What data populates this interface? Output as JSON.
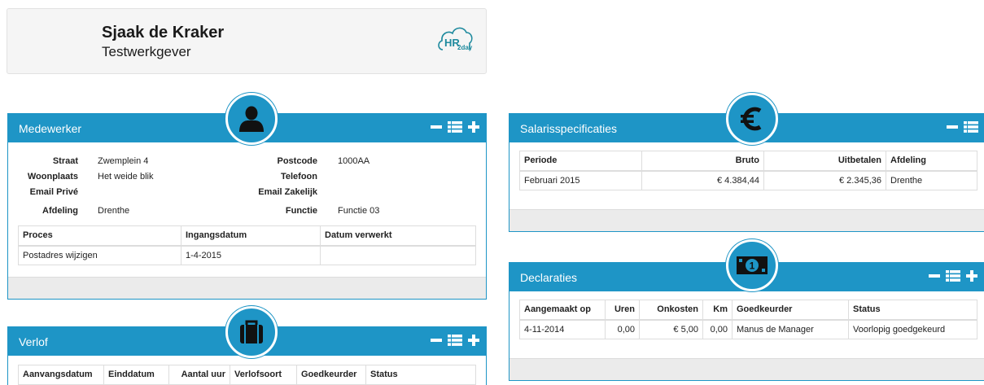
{
  "header": {
    "employee_name": "Sjaak de Kraker",
    "employer": "Testwerkgever",
    "logo_text_main": "HR",
    "logo_text_sub": "2day",
    "logo_icon": "hr2day-cloud-logo"
  },
  "colors": {
    "accent": "#1e95c6",
    "footer": "#ebebeb"
  },
  "medewerker": {
    "title": "Medewerker",
    "icon": "person-icon",
    "fields_left": [
      {
        "label": "Straat",
        "value": "Zwemplein 4"
      },
      {
        "label": "Woonplaats",
        "value": "Het weide blik"
      },
      {
        "label": "Email Privé",
        "value": ""
      },
      {
        "label": "Afdeling",
        "value": "Drenthe"
      }
    ],
    "fields_right": [
      {
        "label": "Postcode",
        "value": "1000AA"
      },
      {
        "label": "Telefoon",
        "value": ""
      },
      {
        "label": "Email Zakelijk",
        "value": ""
      },
      {
        "label": "Functie",
        "value": "Functie 03"
      }
    ],
    "columns": [
      "Proces",
      "Ingangsdatum",
      "Datum verwerkt"
    ],
    "rows": [
      [
        "Postadres wijzigen",
        "1-4-2015",
        ""
      ]
    ]
  },
  "verlof": {
    "title": "Verlof",
    "icon": "briefcase-icon",
    "columns": [
      "Aanvangsdatum",
      "Einddatum",
      "Aantal uur",
      "Verlofsoort",
      "Goedkeurder",
      "Status"
    ]
  },
  "salaris": {
    "title": "Salarisspecificaties",
    "icon": "euro-icon",
    "columns": [
      "Periode",
      "Bruto",
      "Uitbetalen",
      "Afdeling"
    ],
    "rows": [
      [
        "Februari 2015",
        "€ 4.384,44",
        "€ 2.345,36",
        "Drenthe"
      ]
    ]
  },
  "declaraties": {
    "title": "Declaraties",
    "icon": "banknote-icon",
    "columns": [
      "Aangemaakt op",
      "Uren",
      "Onkosten",
      "Km",
      "Goedkeurder",
      "Status"
    ],
    "rows": [
      [
        "4-11-2014",
        "0,00",
        "€ 5,00",
        "0,00",
        "Manus de Manager",
        "Voorlopig goedgekeurd"
      ]
    ]
  }
}
